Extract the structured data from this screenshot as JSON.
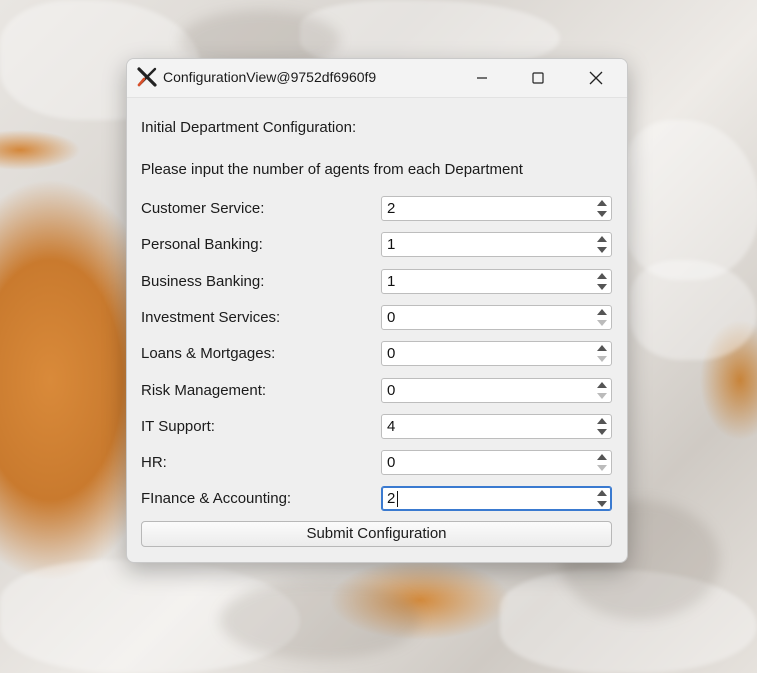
{
  "window": {
    "title": "ConfigurationView@9752df6960f9",
    "app_icon": "x-logo-icon",
    "controls": [
      "minimize-icon",
      "maximize-icon",
      "close-icon"
    ]
  },
  "form": {
    "heading": "Initial Department Configuration:",
    "instruction": "Please input the number of agents from each Department",
    "rows": [
      {
        "label": "Customer Service:",
        "value": "2",
        "down_enabled": true
      },
      {
        "label": "Personal Banking:",
        "value": "1",
        "down_enabled": true
      },
      {
        "label": "Business Banking:",
        "value": "1",
        "down_enabled": true
      },
      {
        "label": "Investment Services:",
        "value": "0",
        "down_enabled": false
      },
      {
        "label": "Loans & Mortgages:",
        "value": "0",
        "down_enabled": false
      },
      {
        "label": "Risk Management:",
        "value": "0",
        "down_enabled": false
      },
      {
        "label": "IT Support:",
        "value": "4",
        "down_enabled": true
      },
      {
        "label": "HR:",
        "value": "0",
        "down_enabled": false
      },
      {
        "label": "FInance & Accounting:",
        "value": "2",
        "down_enabled": true,
        "focused": true
      }
    ],
    "submit_label": "Submit Configuration"
  },
  "colors": {
    "focus_border": "#3a7ad0",
    "window_bg": "#efefef"
  }
}
